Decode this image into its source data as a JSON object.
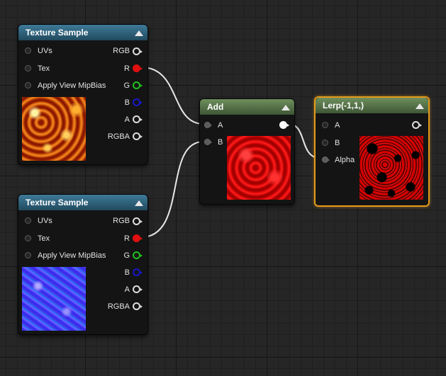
{
  "nodes": {
    "tex1": {
      "title": "Texture Sample",
      "inputs": [
        "UVs",
        "Tex",
        "Apply View MipBias"
      ],
      "outputs": [
        "RGB",
        "R",
        "G",
        "B",
        "A",
        "RGBA"
      ],
      "thumbnail": "fire-texture"
    },
    "tex2": {
      "title": "Texture Sample",
      "inputs": [
        "UVs",
        "Tex",
        "Apply View MipBias"
      ],
      "outputs": [
        "RGB",
        "R",
        "G",
        "B",
        "A",
        "RGBA"
      ],
      "thumbnail": "normal-map-texture"
    },
    "add": {
      "title": "Add",
      "inputs": [
        "A",
        "B"
      ],
      "thumbnail": "red-preview"
    },
    "lerp": {
      "title": "Lerp(-1,1,)",
      "inputs": [
        "A",
        "B",
        "Alpha"
      ],
      "thumbnail": "red-black-preview",
      "selected": true
    }
  },
  "colors": {
    "texture_header": "#2f6a8a",
    "math_header": "#5b7a4c",
    "selection": "#e39a1b",
    "pin_red": "#e01010",
    "pin_green": "#1fbf1f",
    "pin_blue": "#1818c8",
    "wire": "#e8e8e8"
  }
}
